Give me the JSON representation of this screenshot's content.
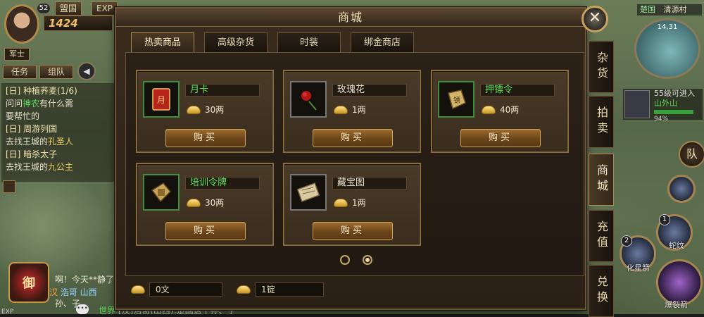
{
  "hud_left": {
    "level": "52",
    "top_buttons": [
      "盟国",
      "EXP"
    ],
    "power": "1424",
    "rank": "军士",
    "tab_task": "任务",
    "tab_team": "组队",
    "quests": [
      {
        "title": "[日] 种植荞麦(1/6)",
        "line1": "问问",
        "npc": "神农",
        "line1b": "有什么需",
        "line2": "要帮忙的"
      },
      {
        "title": "[日] 周游列国",
        "line1": "去找王城的",
        "npc": "孔圣人"
      },
      {
        "title": "[日] 暗杀太子",
        "line1": "去找王城的",
        "npc": "九公主"
      }
    ],
    "chat_1": "啊！今天**静了",
    "chat_2_channel": "汉",
    "chat_2_text": "浩哥 山西",
    "chat_3": "孙、子",
    "world_chat_channel": "世界",
    "world_chat_text": "[汉]浩哥(山西):楚国这个孙、子",
    "bubble": "•••",
    "exp_label": "EXP"
  },
  "hud_right": {
    "zone": "楚国",
    "map_name": "清源村",
    "coords": "14,31",
    "boss_title": "55级可进入",
    "boss_name": "山外山",
    "boss_pct": "94%",
    "team_btn": "队",
    "skill_1_label": "蛇纹",
    "skill_2_label": "化星箭",
    "skill_3_label": "爆裂箭",
    "skill_1_num": "1",
    "skill_2_num": "2"
  },
  "shop": {
    "title": "商城",
    "close": "✕",
    "tabs": [
      "热卖商品",
      "高级杂货",
      "时装",
      "绑金商店"
    ],
    "side_tabs": [
      "杂货",
      "拍卖",
      "商城",
      "充值",
      "兑换"
    ],
    "buy_label": "购买",
    "items": [
      {
        "name": "月卡",
        "price": "30两",
        "color": "green"
      },
      {
        "name": "玫瑰花",
        "price": "1两",
        "color": "white"
      },
      {
        "name": "押镖令",
        "price": "40两",
        "color": "green"
      },
      {
        "name": "培训令牌",
        "price": "30两",
        "color": "green"
      },
      {
        "name": "藏宝图",
        "price": "1两",
        "color": "white"
      }
    ],
    "currency_copper": "0文",
    "currency_ingot": "1锭",
    "page_current": 2,
    "page_total": 2
  }
}
